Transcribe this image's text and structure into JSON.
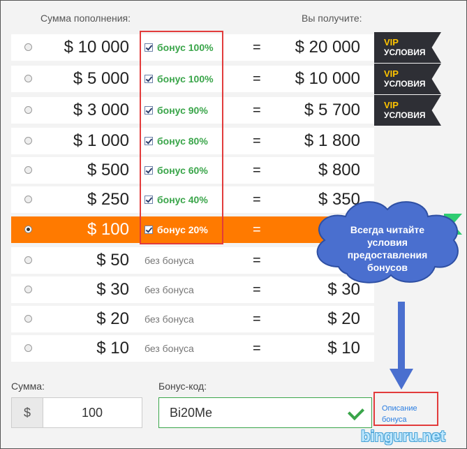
{
  "headers": {
    "amount": "Сумма пополнения:",
    "receive": "Вы получите:"
  },
  "rows": [
    {
      "amount": "$ 10 000",
      "bonus": "бонус 100%",
      "eq": "=",
      "receive": "$ 20 000"
    },
    {
      "amount": "$ 5 000",
      "bonus": "бонус 100%",
      "eq": "=",
      "receive": "$ 10 000"
    },
    {
      "amount": "$ 3 000",
      "bonus": "бонус 90%",
      "eq": "=",
      "receive": "$ 5 700"
    },
    {
      "amount": "$ 1 000",
      "bonus": "бонус 80%",
      "eq": "=",
      "receive": "$ 1 800"
    },
    {
      "amount": "$ 500",
      "bonus": "бонус 60%",
      "eq": "=",
      "receive": "$ 800"
    },
    {
      "amount": "$ 250",
      "bonus": "бонус 40%",
      "eq": "=",
      "receive": "$ 350"
    },
    {
      "amount": "$ 100",
      "bonus": "бонус 20%",
      "eq": "=",
      "receive": "",
      "selected": true
    },
    {
      "amount": "$ 50",
      "bonus": "без бонуса",
      "eq": "=",
      "receive": ""
    },
    {
      "amount": "$ 30",
      "bonus": "без бонуса",
      "eq": "=",
      "receive": "$ 30"
    },
    {
      "amount": "$ 20",
      "bonus": "без бонуса",
      "eq": "=",
      "receive": "$ 20"
    },
    {
      "amount": "$ 10",
      "bonus": "без бонуса",
      "eq": "=",
      "receive": "$ 10"
    }
  ],
  "vip_badges": [
    {
      "line1": "VIP",
      "line2": "УСЛОВИЯ"
    },
    {
      "line1": "VIP",
      "line2": "УСЛОВИЯ"
    },
    {
      "line1": "VIP",
      "line2": "УСЛОВИЯ"
    }
  ],
  "cloud_text": "Всегда читайте условия предоставления бонусов",
  "form": {
    "sum_label": "Сумма:",
    "currency": "$",
    "sum_value": "100",
    "code_label": "Бонус-код:",
    "code_value": "Bi20Me",
    "desc_link": "Описание бонуса"
  },
  "watermark": "binguru.net",
  "colors": {
    "selected_row": "#ff7a00",
    "bonus_green": "#3aa54a",
    "highlight_red": "#e23b3b",
    "link_blue": "#2a7de1"
  }
}
